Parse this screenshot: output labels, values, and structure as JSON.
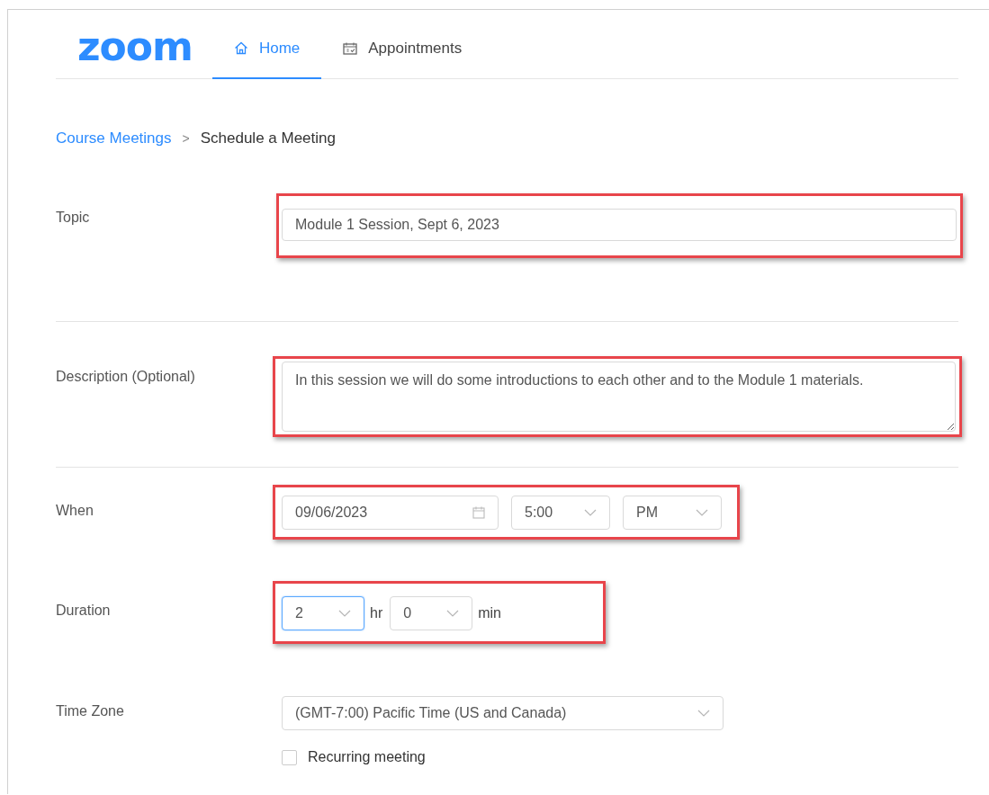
{
  "logo": "zoom",
  "nav_tabs": [
    {
      "label": "Home",
      "kind": "home",
      "selected": true
    },
    {
      "label": "Appointments",
      "kind": "calendar",
      "selected": false
    }
  ],
  "breadcrumb": {
    "parent": "Course Meetings",
    "separator": ">",
    "current": "Schedule a Meeting"
  },
  "topic": {
    "label": "Topic",
    "value": "Module 1 Session, Sept 6, 2023",
    "highlighted": true
  },
  "description": {
    "label": "Description (Optional)",
    "value": "In this session we will do some introductions to each other and to the Module 1 materials.",
    "highlighted": true
  },
  "when": {
    "label": "When",
    "date": "09/06/2023",
    "time": "5:00",
    "ampm": "PM",
    "highlighted": true
  },
  "duration": {
    "label": "Duration",
    "hours": "2",
    "hours_unit": "hr",
    "minutes": "0",
    "minutes_unit": "min",
    "hours_focused": true,
    "highlighted": true
  },
  "time_zone": {
    "label": "Time Zone",
    "value": "(GMT-7:00) Pacific Time (US and Canada)"
  },
  "recurring": {
    "label": "Recurring meeting",
    "checked": false
  }
}
